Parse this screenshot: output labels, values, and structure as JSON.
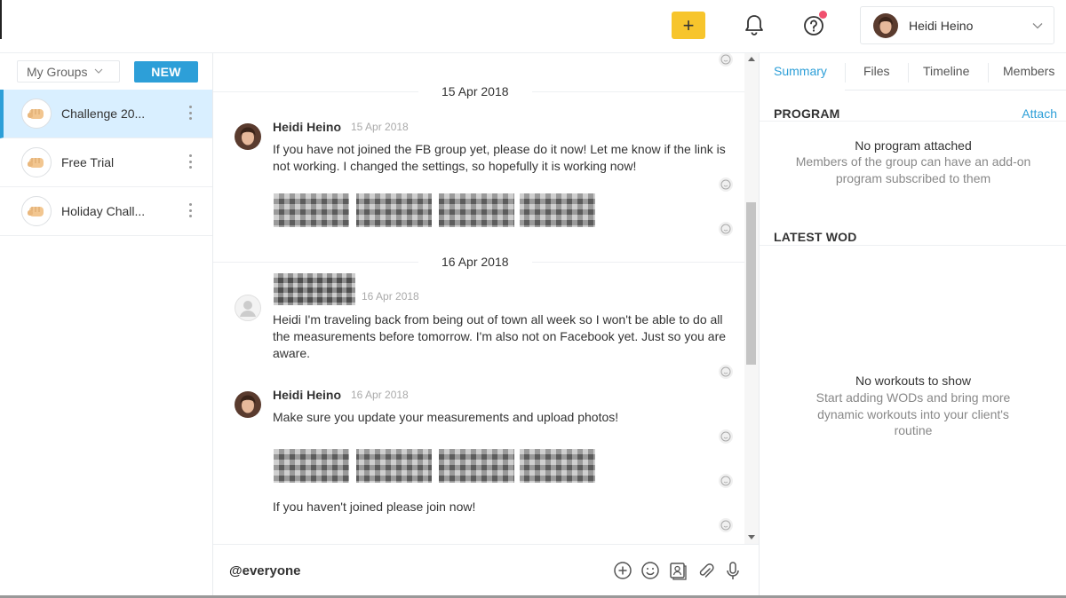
{
  "topbar": {
    "add_label": "+",
    "user_name": "Heidi Heino"
  },
  "sidebar": {
    "filter_value": "My Groups",
    "new_label": "NEW",
    "groups": [
      {
        "label": "Challenge 20...",
        "active": true
      },
      {
        "label": "Free Trial",
        "active": false
      },
      {
        "label": "Holiday Chall...",
        "active": false
      }
    ]
  },
  "chat": {
    "days": [
      {
        "label": "15 Apr 2018"
      },
      {
        "label": "16 Apr 2018"
      }
    ],
    "messages": [
      {
        "author": "Heidi Heino",
        "time": "15 Apr 2018",
        "text": "If you have not joined the FB group yet, please do it now! Let me know if the link is not working. I changed the settings, so hopefully it is working now!"
      },
      {
        "author": "",
        "time": "16 Apr 2018",
        "text": "Heidi I'm traveling back from being out of town all week so I won't be able to do all the measurements before tomorrow. I'm also not on Facebook yet. Just so you are aware."
      },
      {
        "author": "Heidi Heino",
        "time": "16 Apr 2018",
        "text": "Make sure you update your measurements and upload photos!"
      },
      {
        "author": "",
        "time": "",
        "text": "If you haven't joined please join now!"
      }
    ]
  },
  "composer": {
    "value": "@everyone",
    "icons": [
      "add-circle-icon",
      "emoji-icon",
      "contact-card-icon",
      "paperclip-icon",
      "microphone-icon"
    ]
  },
  "right_panel": {
    "tabs": [
      "Summary",
      "Files",
      "Timeline",
      "Members"
    ],
    "active_tab": "Summary",
    "program": {
      "title": "PROGRAM",
      "attach_label": "Attach",
      "empty_title": "No program attached",
      "empty_sub": "Members of the group can have an add-on program subscribed to them"
    },
    "wod": {
      "title": "LATEST WOD",
      "empty_title": "No workouts to show",
      "empty_sub": "Start adding WODs and bring more dynamic workouts into your client's routine"
    }
  },
  "colors": {
    "accent": "#2d9fd8",
    "add_button": "#f7c52c",
    "active_group_bg": "#d9efff",
    "notification_dot": "#f0506e"
  }
}
